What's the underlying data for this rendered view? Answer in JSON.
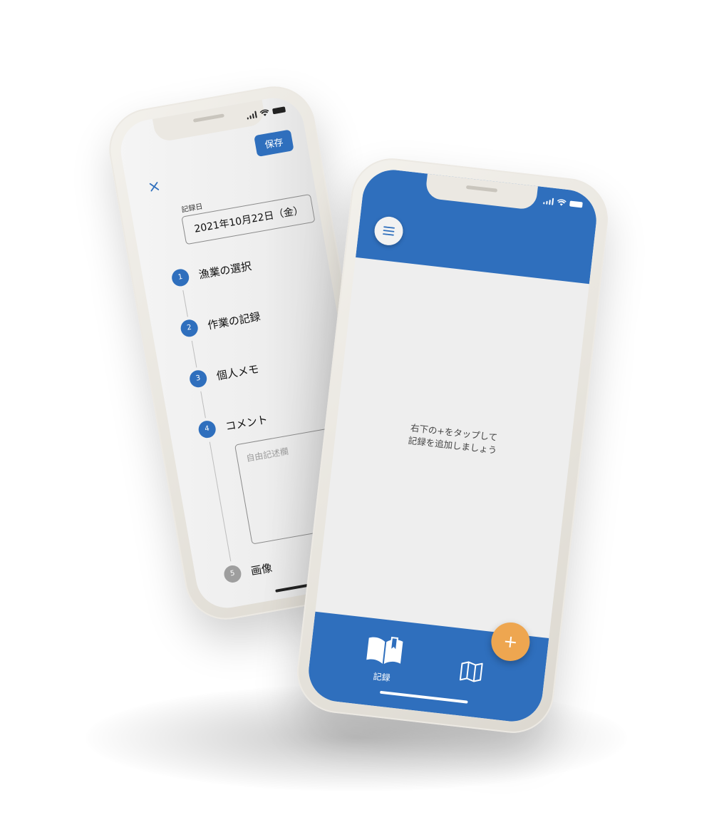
{
  "form_screen": {
    "save_label": "保存",
    "date_label": "記録日",
    "date_value": "2021年10月22日（金）",
    "steps": [
      {
        "number": "1",
        "title": "漁業の選択"
      },
      {
        "number": "2",
        "title": "作業の記録"
      },
      {
        "number": "3",
        "title": "個人メモ"
      },
      {
        "number": "4",
        "title": "コメント"
      },
      {
        "number": "5",
        "title": "画像"
      }
    ],
    "comment_placeholder": "自由記述欄"
  },
  "main_screen": {
    "empty_message_line1": "右下の+をタップして",
    "empty_message_line2": "記録を追加しましょう",
    "nav_records_label": "記録",
    "fab_label": "+"
  },
  "colors": {
    "primary": "#2f6fbd",
    "accent": "#eea650",
    "inactive_step": "#9e9e9e",
    "screen_background": "#eeeeee"
  },
  "icons": {
    "close": "close-icon",
    "menu": "menu-icon",
    "records": "open-book-icon",
    "map": "map-icon",
    "add": "plus-icon"
  }
}
